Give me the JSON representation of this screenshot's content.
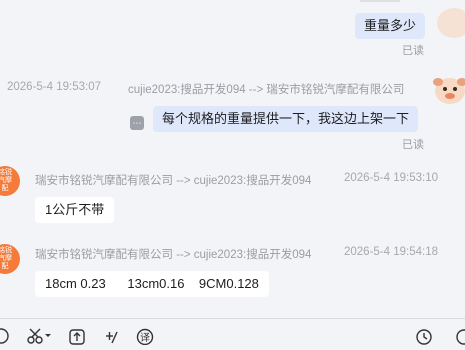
{
  "messages": [
    {
      "direction": "out",
      "text": "重量多少",
      "status": "已读"
    },
    {
      "direction": "out",
      "timestamp": "2026-5-4 19:53:07",
      "sender": "cujie2023:搜品开发094 --> 瑞安市铭锐汽摩配有限公司",
      "text": "每个规格的重量提供一下，我这边上架一下",
      "status": "已读"
    },
    {
      "direction": "in",
      "sender": "瑞安市铭锐汽摩配有限公司 --> cujie2023:搜品开发094",
      "timestamp": "2026-5-4 19:53:10",
      "text": "1公斤不带",
      "avatar_text": "铭锐汽摩配"
    },
    {
      "direction": "in",
      "sender": "瑞安市铭锐汽摩配有限公司 --> cujie2023:搜品开发094",
      "timestamp": "2026-5-4 19:54:18",
      "text": "18cm 0.23      13cm0.16    9CM0.128",
      "avatar_text": "铭锐汽摩配"
    }
  ],
  "toolbar": {
    "icons": [
      "emoji-icon",
      "scissors-icon",
      "upload-icon",
      "quick-phrase-icon",
      "translate-icon",
      "history-icon"
    ],
    "translate_glyph": "译"
  },
  "colors": {
    "background": "#f3f4f7",
    "bubble_out": "#dfe8fb",
    "bubble_in": "#ffffff",
    "avatar_shop": "#f47b3a",
    "meta_text": "#a6a8ad"
  }
}
